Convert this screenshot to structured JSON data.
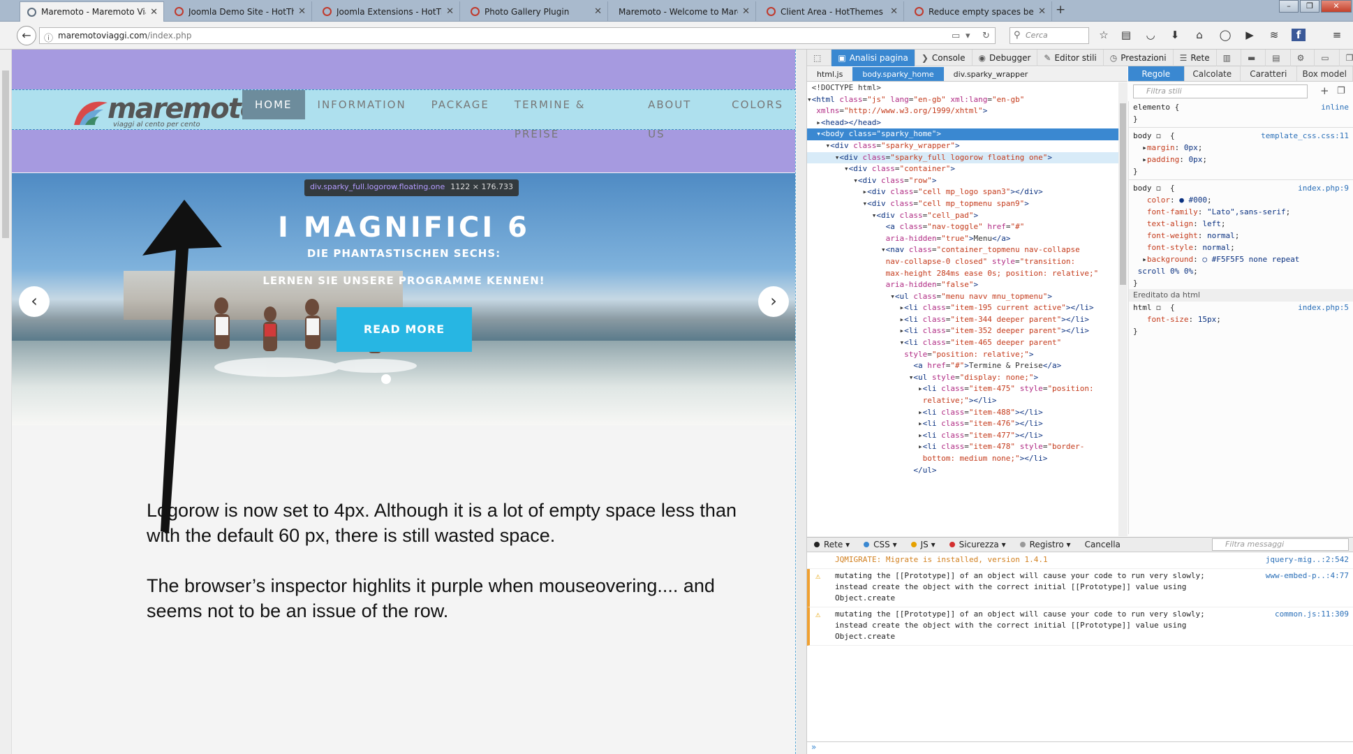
{
  "tabs": [
    {
      "title": "Maremoto - Maremoto Viaggi ...",
      "active": true
    },
    {
      "title": "Joomla Demo Site - HotTh..."
    },
    {
      "title": "Joomla Extensions - HotTh..."
    },
    {
      "title": "Photo Gallery Plugin"
    },
    {
      "title": "Maremoto - Welcome to Mare..."
    },
    {
      "title": "Client Area - HotThemes"
    },
    {
      "title": "Reduce empty spaces betw..."
    }
  ],
  "address": {
    "host": "maremotoviaggi.com",
    "path": "/index.php"
  },
  "search": {
    "placeholder": "Cerca"
  },
  "site": {
    "logo_text": "maremoto",
    "logo_tagline": "viaggi al cento per cento",
    "menu": [
      "HOME",
      "INFORMATION",
      "PACKAGE",
      "TERMINE & PREISE",
      "ABOUT US",
      "COLORS"
    ],
    "tooltip_selector": "div.sparky_full.logorow.floating.one",
    "tooltip_size": "1122 × 176.733"
  },
  "hero": {
    "title": "I MAGNIFICI 6",
    "subtitle": "DIE PHANTASTISCHEN SECHS:",
    "tagline": "LERNEN SIE UNSERE PROGRAMME KENNEN!",
    "button": "READ MORE",
    "prev": "‹",
    "next": "›"
  },
  "note": {
    "p1": "Logorow is now set to 4px. Although it is a lot of empty space less than with the default 60 px, there is still wasted space.",
    "p2": "The browser’s inspector highlits it purple when mouseovering.... and seems not to be an issue of the row."
  },
  "devtools": {
    "toolbar": [
      "Analisi pagina",
      "Console",
      "Debugger",
      "Editor stili",
      "Prestazioni",
      "Rete"
    ],
    "breadcrumbs": [
      "html.js",
      "body.sparky_home",
      "div.sparky_wrapper"
    ],
    "rule_tabs": [
      "Regole",
      "Calcolate",
      "Caratteri",
      "Box model"
    ],
    "filter_styles": "Filtra stili",
    "inherited_header": "Ereditato da html",
    "console_filters": [
      "Rete",
      "CSS",
      "JS",
      "Sicurezza",
      "Registro"
    ],
    "console_clear": "Cancella",
    "filter_messages": "Filtra messaggi",
    "console_messages": [
      {
        "text": "JQMIGRATE: Migrate is installed, version 1.4.1",
        "source": "jquery-mig..:2:542",
        "level": "info"
      },
      {
        "text": "mutating the [[Prototype]] of an object will cause your code to run very slowly;\ninstead create the object with the correct initial [[Prototype]] value using\nObject.create",
        "source": "www-embed-p..:4:77",
        "level": "warn"
      },
      {
        "text": "mutating the [[Prototype]] of an object will cause your code to run very slowly;\ninstead create the object with the correct initial [[Prototype]] value using\nObject.create",
        "source": "common.js:11:309",
        "level": "warn"
      }
    ]
  },
  "colors": {
    "highlight": "#a69ae0",
    "accent": "#3a88d1",
    "cta": "#27b6e3"
  }
}
